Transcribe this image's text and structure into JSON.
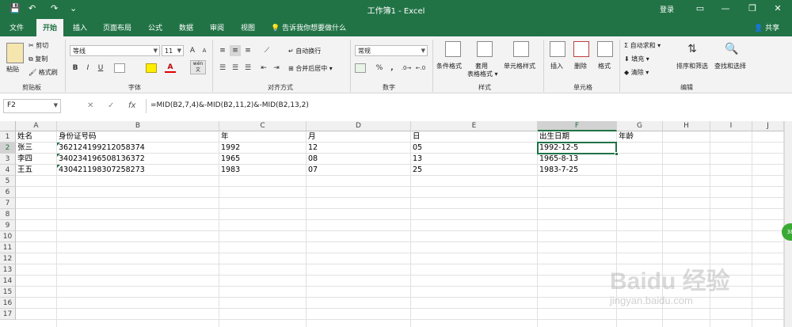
{
  "window": {
    "title": "工作簿1 - Excel",
    "login": "登录",
    "controls": [
      "▭",
      "—",
      "❐",
      "✕"
    ]
  },
  "quick_access": {
    "save": "💾",
    "undo": "↶",
    "redo": "↷",
    "customize": "⌄"
  },
  "tabs": [
    "文件",
    "开始",
    "插入",
    "页面布局",
    "公式",
    "数据",
    "审阅",
    "视图"
  ],
  "active_tab": "开始",
  "tell_me": "告诉我你想要做什么",
  "share": "共享",
  "ribbon": {
    "clipboard": {
      "paste": "粘贴",
      "cut": "剪切",
      "copy": "复制",
      "format_painter": "格式刷",
      "label": "剪贴板"
    },
    "font": {
      "name": "等线",
      "size": "11",
      "grow": "A",
      "shrink": "A",
      "bold": "B",
      "italic": "I",
      "underline": "U",
      "wen": "wén 文",
      "label": "字体"
    },
    "alignment": {
      "wrap": "自动换行",
      "merge": "合并后居中",
      "label": "对齐方式"
    },
    "number": {
      "format": "常规",
      "percent": "%",
      "comma": ",",
      "label": "数字"
    },
    "styles": {
      "conditional": "条件格式",
      "table": "套用\n表格格式",
      "cell_styles": "单元格样式",
      "label": "样式"
    },
    "cells": {
      "insert": "插入",
      "delete": "删除",
      "format": "格式",
      "label": "单元格"
    },
    "editing": {
      "autosum": "自动求和",
      "fill": "填充",
      "clear": "清除",
      "sort": "排序和筛选",
      "find": "查找和选择",
      "label": "编辑"
    }
  },
  "formula_bar": {
    "name_box": "F2",
    "cancel": "✕",
    "enter": "✓",
    "fx": "fx",
    "formula": "=MID(B2,7,4)&-MID(B2,11,2)&-MID(B2,13,2)"
  },
  "columns": [
    "A",
    "B",
    "C",
    "D",
    "E",
    "F",
    "G",
    "H",
    "I",
    "J"
  ],
  "selected_column": "F",
  "rows": [
    "1",
    "2",
    "3",
    "4",
    "5",
    "6",
    "7",
    "8",
    "9",
    "10",
    "11",
    "12",
    "13",
    "14",
    "15",
    "16",
    "17"
  ],
  "selected_row": "2",
  "cells": {
    "A1": "姓名",
    "B1": "身份证号码",
    "C1": "年",
    "D1": "月",
    "E1": "日",
    "F1": "出生日期",
    "G1": "年龄",
    "A2": "张三",
    "B2": "362124199212058374",
    "C2": "1992",
    "D2": "12",
    "E2": "05",
    "F2": "1992-12-5",
    "A3": "李四",
    "B3": "340234196508136372",
    "C3": "1965",
    "D3": "08",
    "E3": "13",
    "F3": "1965-8-13",
    "A4": "王五",
    "B4": "430421198307258273",
    "C4": "1983",
    "D4": "07",
    "E4": "25",
    "F4": "1983-7-25"
  },
  "side_badge": "38",
  "watermark": {
    "main": "Baidu 经验",
    "sub": "jingyan.baidu.com"
  }
}
